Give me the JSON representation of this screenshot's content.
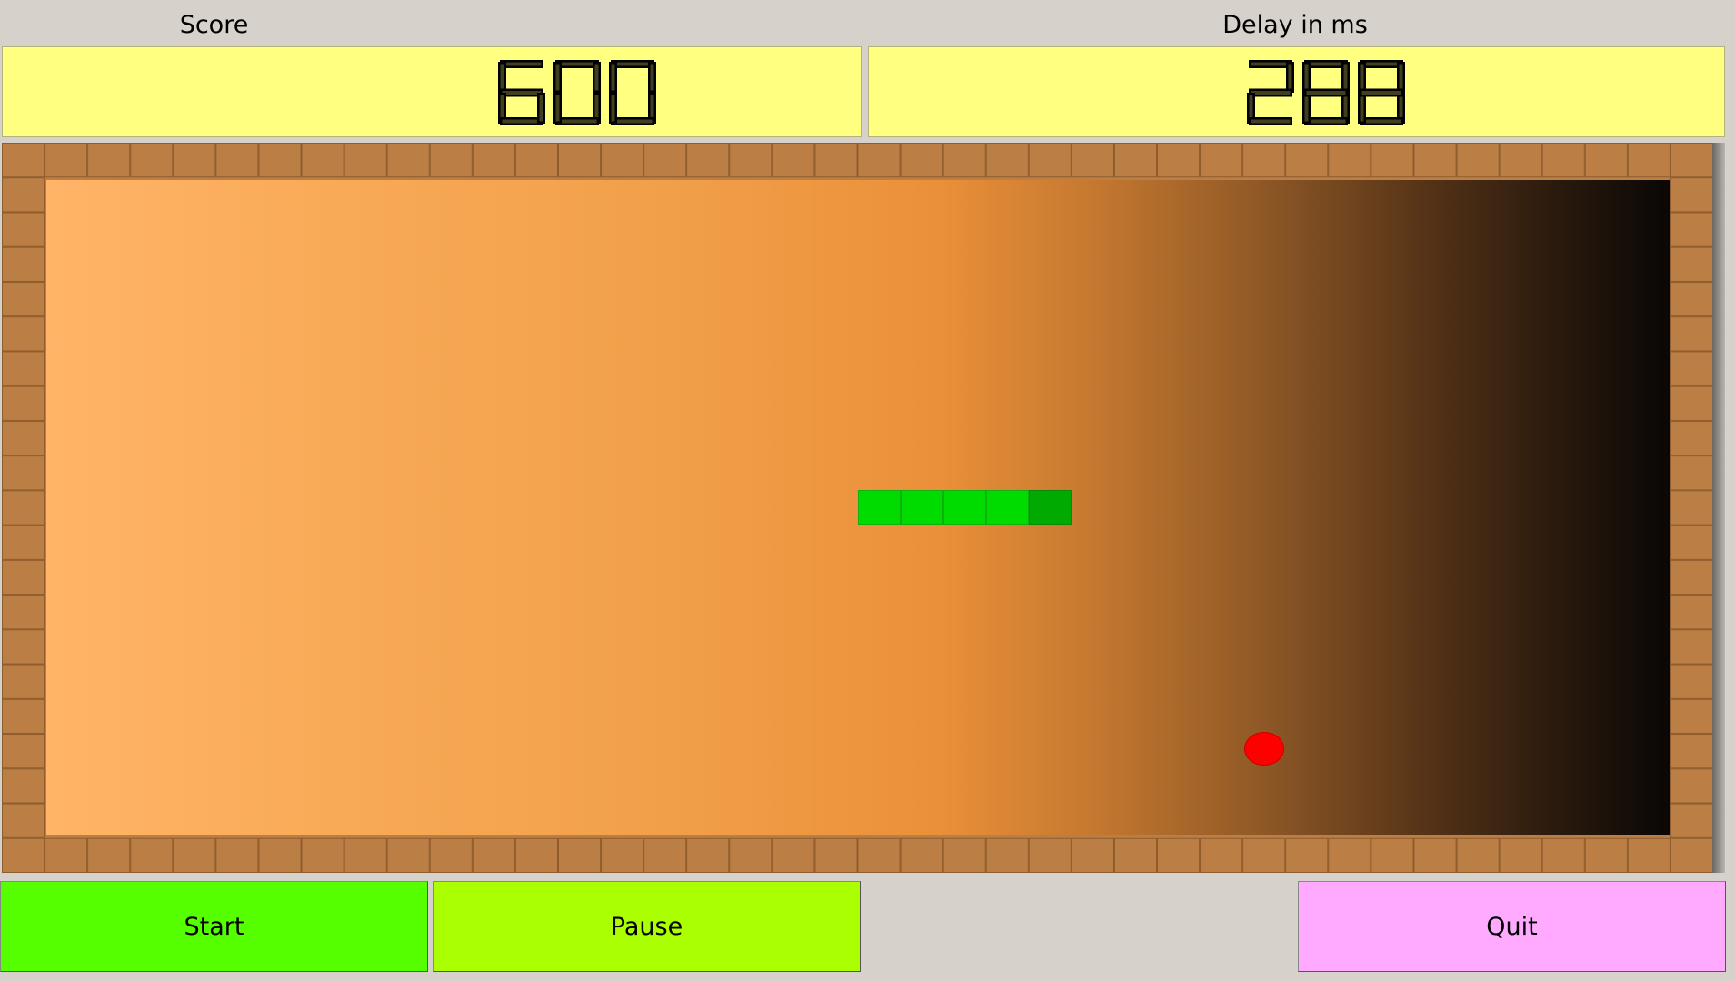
{
  "header": {
    "score_label": "Score",
    "delay_label": "Delay in ms",
    "score_value": "600",
    "delay_value": "288"
  },
  "buttons": {
    "start_label": "Start",
    "pause_label": "Pause",
    "quit_label": "Quit"
  },
  "colors": {
    "lcd_background": "#ffff80",
    "brick": "#bb7f45",
    "brick_mortar": "#8f5c2e",
    "snake_body": "#00dc00",
    "snake_head": "#00aa00",
    "food": "#ff0000",
    "start_button": "#55ff00",
    "pause_button": "#aaff00",
    "quit_button": "#ffaaff"
  },
  "game": {
    "grid_cols": 38,
    "grid_rows": 19,
    "snake": [
      {
        "col": 19,
        "row": 9
      },
      {
        "col": 20,
        "row": 9
      },
      {
        "col": 21,
        "row": 9
      },
      {
        "col": 22,
        "row": 9
      },
      {
        "col": 23,
        "row": 9
      }
    ],
    "snake_head_index": 4,
    "food": {
      "col": 28,
      "row": 16
    }
  }
}
